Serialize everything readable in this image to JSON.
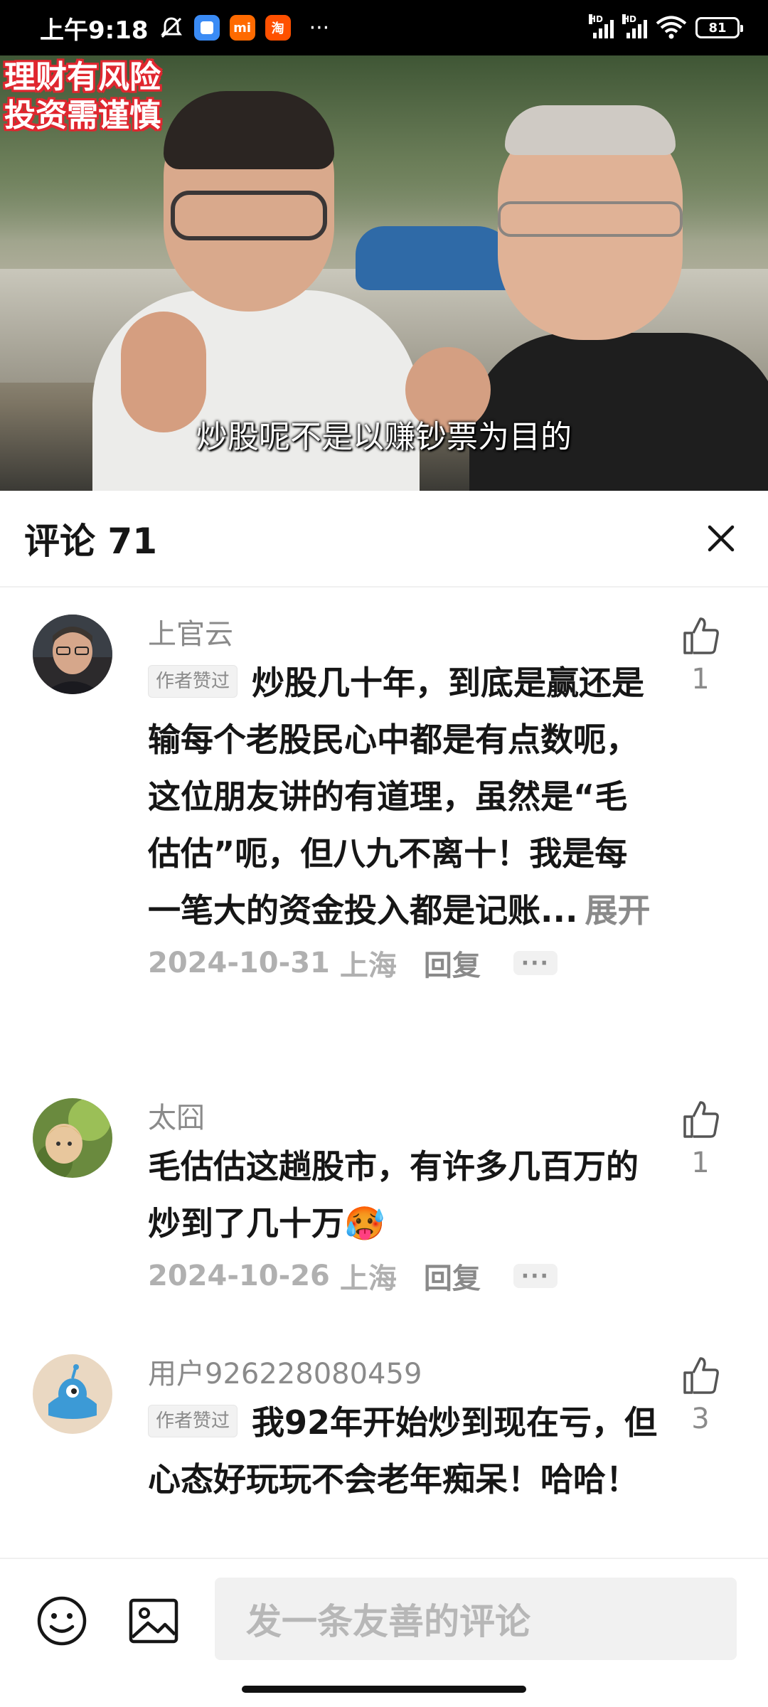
{
  "status_bar": {
    "time": "上午9:18",
    "apps": [
      {
        "name": "bell-off-icon"
      },
      {
        "name": "app-blue-icon",
        "color": "#3a8bf5",
        "label": ""
      },
      {
        "name": "mi-app-icon",
        "color": "#ff6a00",
        "label": "mi"
      },
      {
        "name": "taobao-icon",
        "color": "#ff5000",
        "label": "淘"
      }
    ],
    "more": "···",
    "signal_labels": [
      "HD",
      "HD"
    ],
    "battery": "81"
  },
  "video": {
    "warning_line1": "理财有风险",
    "warning_line2": "投资需谨慎",
    "subtitle": "炒股呢不是以赚钞票为目的"
  },
  "comments_sheet": {
    "title": "评论 71",
    "comments": [
      {
        "username": "上官云",
        "tag": "作者赞过",
        "text": "炒股几十年，到底是赢还是输每个老股民心中都是有点数呃，这位朋友讲的有道理，虽然是“毛估估”呃，但八九不离十！我是每一笔大的资金投入都是记账...",
        "expand": "展开",
        "date": "2024-10-31",
        "location": "上海",
        "reply": "回复",
        "more": "···",
        "likes": "1"
      },
      {
        "username": "太囧",
        "tag": "",
        "text": "毛估估这趟股市，有许多几百万的炒到了几十万",
        "emoji": "🥵",
        "date": "2024-10-26",
        "location": "上海",
        "reply": "回复",
        "more": "···",
        "likes": "1"
      },
      {
        "username": "用户926228080459",
        "tag": "作者赞过",
        "text": "我92年开始炒到现在亏，但心态好玩玩不会老年痴呆！哈哈！",
        "likes": "3"
      }
    ]
  },
  "bottom_bar": {
    "placeholder": "发一条友善的评论"
  },
  "colors": {
    "accent_red": "#e0262f",
    "text_primary": "#161616",
    "text_secondary": "#8a8a8a"
  }
}
